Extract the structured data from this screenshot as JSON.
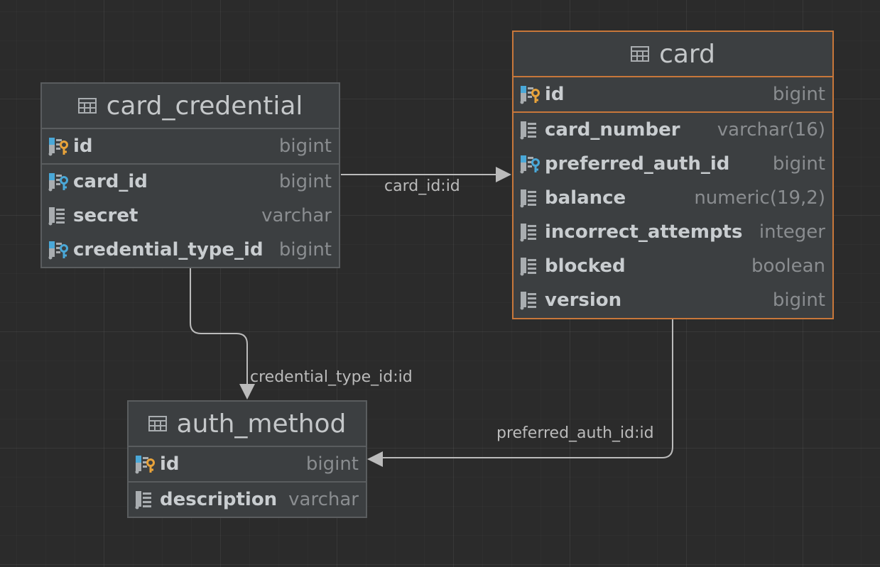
{
  "tables": {
    "card_credential": {
      "title": "card_credential",
      "pk": {
        "name": "id",
        "type": "bigint",
        "icon": "pk-column-icon"
      },
      "columns": [
        {
          "name": "card_id",
          "type": "bigint",
          "icon": "fk-column-icon"
        },
        {
          "name": "secret",
          "type": "varchar",
          "icon": "column-icon"
        },
        {
          "name": "credential_type_id",
          "type": "bigint",
          "icon": "fk-column-icon"
        }
      ]
    },
    "card": {
      "title": "card",
      "selected": true,
      "pk": {
        "name": "id",
        "type": "bigint",
        "icon": "pk-column-icon"
      },
      "columns": [
        {
          "name": "card_number",
          "type": "varchar(16)",
          "icon": "column-icon"
        },
        {
          "name": "preferred_auth_id",
          "type": "bigint",
          "icon": "fk-column-icon"
        },
        {
          "name": "balance",
          "type": "numeric(19,2)",
          "icon": "column-icon"
        },
        {
          "name": "incorrect_attempts",
          "type": "integer",
          "icon": "column-icon"
        },
        {
          "name": "blocked",
          "type": "boolean",
          "icon": "column-icon"
        },
        {
          "name": "version",
          "type": "bigint",
          "icon": "column-icon"
        }
      ]
    },
    "auth_method": {
      "title": "auth_method",
      "pk": {
        "name": "id",
        "type": "bigint",
        "icon": "pk-column-icon"
      },
      "columns": [
        {
          "name": "description",
          "type": "varchar",
          "icon": "column-icon"
        }
      ]
    }
  },
  "relations": [
    {
      "from": "card_credential",
      "to": "card",
      "label": "card_id:id"
    },
    {
      "from": "card_credential",
      "to": "auth_method",
      "label": "credential_type_id:id"
    },
    {
      "from": "card",
      "to": "auth_method",
      "label": "preferred_auth_id:id"
    }
  ],
  "colors": {
    "background": "#2b2b2b",
    "table_body": "#3c3f41",
    "table_border": "#5a5d5f",
    "selected_border": "#c8773a",
    "primary_key": "#e8a33a",
    "foreign_key": "#4aa8d8",
    "edge": "#bbbbbb"
  }
}
